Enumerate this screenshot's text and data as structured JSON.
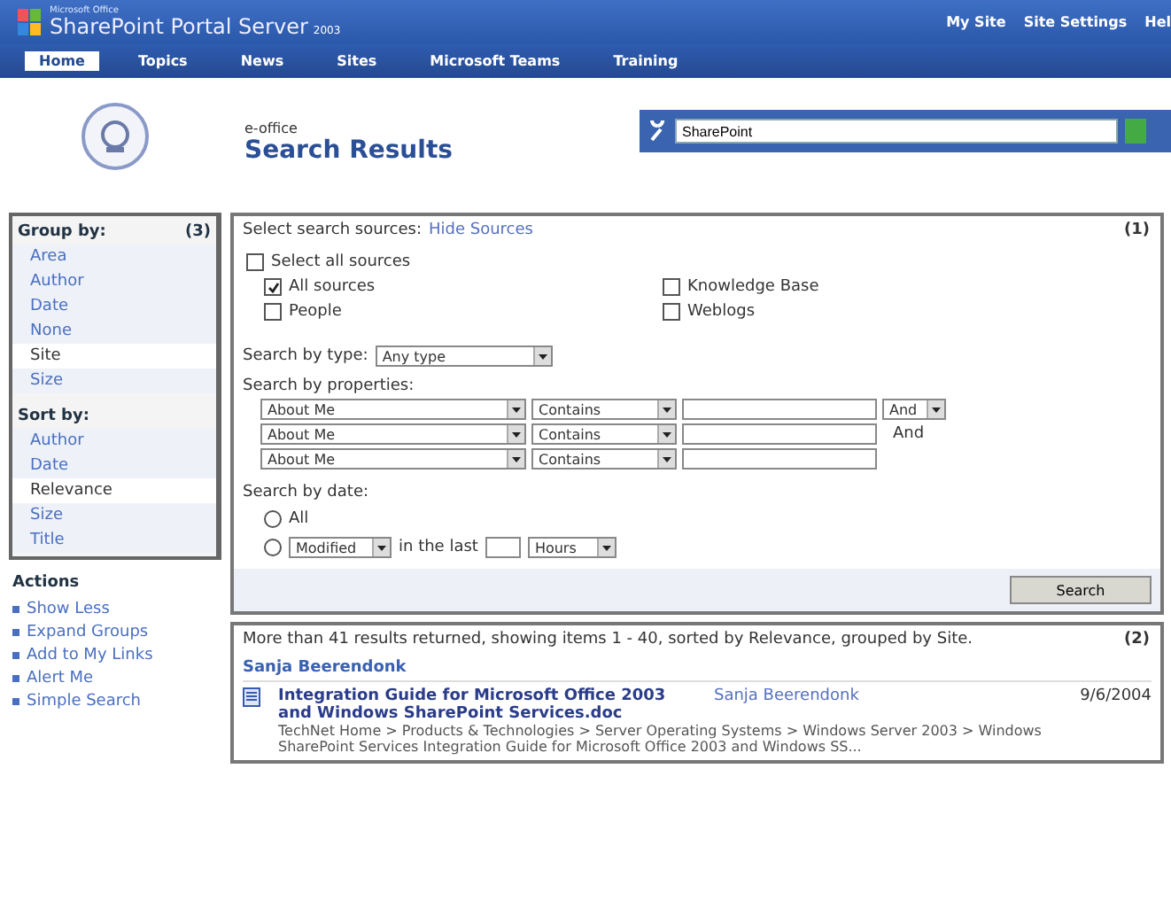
{
  "header": {
    "brand_small": "Microsoft Office",
    "brand": "SharePoint Portal Server",
    "brand_year": "2003",
    "links": [
      "My Site",
      "Site Settings",
      "Hel"
    ]
  },
  "nav": [
    {
      "label": "Home",
      "selected": true
    },
    {
      "label": "Topics",
      "selected": false
    },
    {
      "label": "News",
      "selected": false
    },
    {
      "label": "Sites",
      "selected": false
    },
    {
      "label": "Microsoft Teams",
      "selected": false
    },
    {
      "label": "Training",
      "selected": false
    }
  ],
  "page": {
    "site": "e-office",
    "title": "Search Results"
  },
  "search": {
    "value": "SharePoint"
  },
  "group_by": {
    "title": "Group by:",
    "badge": "(3)",
    "items": [
      {
        "label": "Area",
        "selected": false
      },
      {
        "label": "Author",
        "selected": false
      },
      {
        "label": "Date",
        "selected": false
      },
      {
        "label": "None",
        "selected": false
      },
      {
        "label": "Site",
        "selected": true
      },
      {
        "label": "Size",
        "selected": false
      }
    ]
  },
  "sort_by": {
    "title": "Sort by:",
    "items": [
      {
        "label": "Author",
        "selected": false
      },
      {
        "label": "Date",
        "selected": false
      },
      {
        "label": "Relevance",
        "selected": true
      },
      {
        "label": "Size",
        "selected": false
      },
      {
        "label": "Title",
        "selected": false
      }
    ]
  },
  "actions": {
    "title": "Actions",
    "items": [
      "Show Less",
      "Expand Groups",
      "Add to My Links",
      "Alert Me",
      "Simple Search"
    ]
  },
  "query": {
    "sources_label": "Select search sources:",
    "sources_link": "Hide Sources",
    "badge": "(1)",
    "select_all": {
      "label": "Select all sources",
      "checked": false
    },
    "sources": [
      {
        "label": "All sources",
        "checked": true
      },
      {
        "label": "Knowledge Base",
        "checked": false
      },
      {
        "label": "People",
        "checked": false
      },
      {
        "label": "Weblogs",
        "checked": false
      }
    ],
    "type_label": "Search by type:",
    "type_value": "Any type",
    "properties_label": "Search by properties:",
    "properties": [
      {
        "property": "About Me",
        "operator": "Contains",
        "kind": "select",
        "joiner": "And"
      },
      {
        "property": "About Me",
        "operator": "Contains",
        "kind": "text",
        "joiner": "And"
      },
      {
        "property": "About Me",
        "operator": "Contains",
        "kind": "none"
      }
    ],
    "date_label": "Search by date:",
    "date_all": {
      "label": "All",
      "selected": false
    },
    "date_range": {
      "selected": false,
      "field": "Modified",
      "middle": "in the last",
      "unit": "Hours"
    },
    "button": "Search"
  },
  "results": {
    "summary": "More than 41 results returned, showing items 1 - 40, sorted by Relevance, grouped by Site.",
    "badge": "(2)",
    "group": "Sanja Beerendonk",
    "items": [
      {
        "title": "Integration Guide for Microsoft Office 2003 and Windows SharePoint Services.doc",
        "author": "Sanja Beerendonk",
        "date": "9/6/2004",
        "description": "TechNet Home > Products & Technologies > Server Operating Systems > Windows Server 2003 > Windows SharePoint Services Integration Guide for Microsoft Office 2003 and Windows SS..."
      }
    ]
  }
}
